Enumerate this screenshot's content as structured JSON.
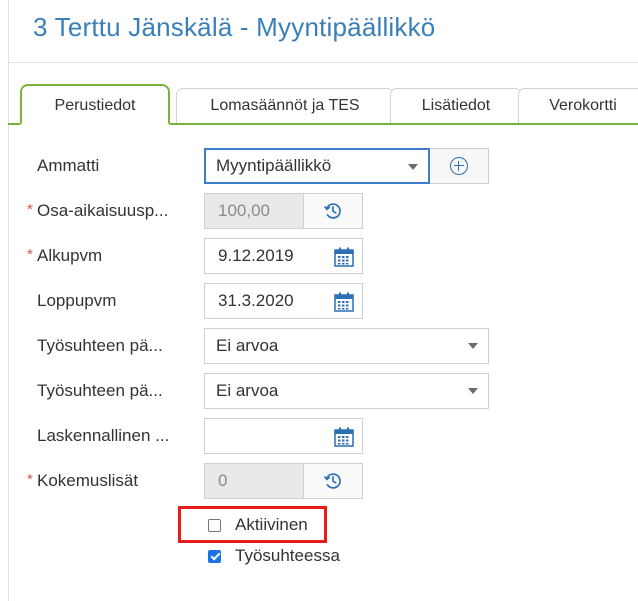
{
  "header": {
    "title": "3 Terttu Jänskälä - Myyntipäällikkö"
  },
  "tabs": [
    {
      "label": "Perustiedot",
      "active": true
    },
    {
      "label": "Lomasäännöt ja TES",
      "active": false
    },
    {
      "label": "Lisätiedot",
      "active": false
    },
    {
      "label": "Verokortti",
      "active": false
    }
  ],
  "form": {
    "required_marker": "*",
    "ammatti": {
      "label": "Ammatti",
      "value": "Myyntipäällikkö"
    },
    "osa_aikaisuus": {
      "label": "Osa-aikaisuusp...",
      "value": "100,00",
      "required": true
    },
    "alkupvm": {
      "label": "Alkupvm",
      "value": "9.12.2019",
      "required": true
    },
    "loppupvm": {
      "label": "Loppupvm",
      "value": "31.3.2020"
    },
    "tyosuhteen_1": {
      "label": "Työsuhteen pä...",
      "value": "Ei arvoa"
    },
    "tyosuhteen_2": {
      "label": "Työsuhteen pä...",
      "value": "Ei arvoa"
    },
    "laskennallinen": {
      "label": "Laskennallinen ...",
      "value": ""
    },
    "kokemuslisat": {
      "label": "Kokemuslisät",
      "value": "0",
      "required": true
    }
  },
  "checkboxes": {
    "aktiivinen": {
      "label": "Aktiivinen",
      "checked": false
    },
    "tyosuhteessa": {
      "label": "Työsuhteessa",
      "checked": true
    }
  },
  "colors": {
    "title": "#3a7fb8",
    "tab_accent": "#7ab33a",
    "focus": "#3b7dc8",
    "required": "#d9534f",
    "highlight": "#e81a1a",
    "checkbox_checked": "#1a73e8"
  },
  "icons": {
    "add": "add-circle-icon",
    "history": "history-icon",
    "calendar": "calendar-icon",
    "dropdown": "chevron-down-icon"
  }
}
